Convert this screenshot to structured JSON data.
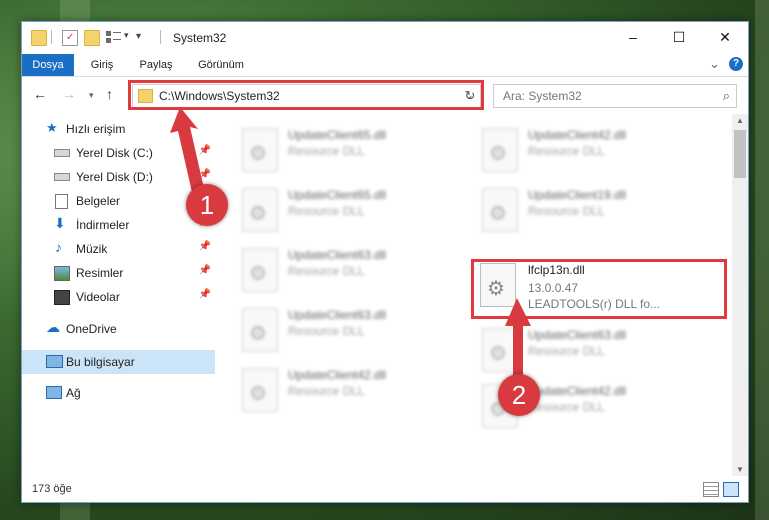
{
  "window": {
    "title": "System32",
    "minimize_label": "–",
    "maximize_label": "☐",
    "close_label": "✕"
  },
  "ribbon": {
    "tabs": [
      {
        "label": "Dosya",
        "active": true
      },
      {
        "label": "Giriş"
      },
      {
        "label": "Paylaş"
      },
      {
        "label": "Görünüm"
      }
    ],
    "collapse_label": "⌄",
    "help_label": "?"
  },
  "address_bar": {
    "path": "C:\\Windows\\System32",
    "dropdown_label": "⌄",
    "refresh_label": "↻"
  },
  "search": {
    "placeholder": "Ara: System32"
  },
  "nav_pane": {
    "items": [
      {
        "label": "Hızlı erişim"
      },
      {
        "label": "Yerel Disk (C:)"
      },
      {
        "label": "Yerel Disk (D:)"
      },
      {
        "label": "Belgeler"
      },
      {
        "label": "İndirmeler"
      },
      {
        "label": "Müzik"
      },
      {
        "label": "Resimler"
      },
      {
        "label": "Videolar"
      },
      {
        "label": "OneDrive"
      },
      {
        "label": "Bu bilgisayar",
        "selected": true
      },
      {
        "label": "Ağ"
      }
    ]
  },
  "files": {
    "col1": [
      {
        "name": "UpdateClient65.dll",
        "type": "Resource DLL"
      },
      {
        "name": "UpdateClient65.dll",
        "type": "Resource DLL"
      },
      {
        "name": "UpdateClient63.dll",
        "type": "Resource DLL"
      },
      {
        "name": "UpdateClient63.dll",
        "type": "Resource DLL"
      },
      {
        "name": "UpdateClient42.dll",
        "type": "Resource DLL"
      }
    ],
    "col2": [
      {
        "name": "UpdateClient42.dll",
        "type": "Resource DLL"
      },
      {
        "name": "UpdateClient19.dll",
        "type": "Resource DLL"
      },
      {
        "name": "UpdateClient63.dll",
        "type": "Resource DLL"
      },
      {
        "name": "UpdateClient42.dll",
        "type": "Resource DLL"
      }
    ],
    "highlighted": {
      "name": "lfclp13n.dll",
      "version": "13.0.0.47",
      "description": "LEADTOOLS(r) DLL fo..."
    }
  },
  "status_bar": {
    "count": "173 öğe"
  },
  "annotations": {
    "badge1": "1",
    "badge2": "2"
  },
  "colors": {
    "accent": "#1a6fc4",
    "highlight_red": "#e0393e",
    "badge_red": "#d93a3f",
    "selection": "#cce4f7"
  }
}
